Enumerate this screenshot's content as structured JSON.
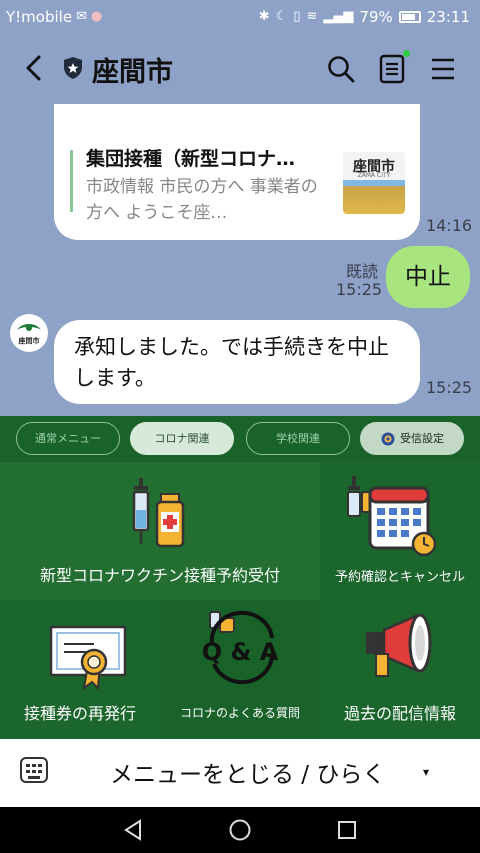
{
  "status_bar": {
    "carrier": "Y!mobile",
    "battery": "79%",
    "time": "23:11"
  },
  "header": {
    "title": "座間市"
  },
  "chat": {
    "link_card": {
      "title": "集団接種（新型コロナ…",
      "description": "市政情報 市民の方へ 事業者の方へ ようこそ座…",
      "thumb_title": "座間市",
      "thumb_sub": "ZAMA CITY",
      "time": "14:16"
    },
    "my_message": {
      "text": "中止",
      "read": "既読",
      "time": "15:25"
    },
    "bot_message": {
      "avatar_text": "座間市",
      "text": "承知しました。では手続きを中止します。",
      "time": "15:25"
    }
  },
  "rich_menu": {
    "tabs": [
      {
        "label": "通常メニュー"
      },
      {
        "label": "コロナ関連"
      },
      {
        "label": "学校関連"
      },
      {
        "label": "受信設定"
      }
    ],
    "items": [
      {
        "label": "新型コロナワクチン接種予約受付",
        "icon": "vaccine-icon"
      },
      {
        "label": "予約確認とキャンセル",
        "icon": "calendar-icon"
      },
      {
        "label": "接種券の再発行",
        "icon": "certificate-icon"
      },
      {
        "label": "コロナのよくある質問",
        "icon": "qa-icon",
        "icon_text": "Q & A"
      },
      {
        "label": "過去の配信情報",
        "icon": "megaphone-icon"
      }
    ]
  },
  "menu_bar": {
    "label": "メニューをとじる / ひらく",
    "caret": "▾"
  },
  "colors": {
    "bg": "#8ea2c8",
    "menu_green": "#19622a",
    "my_bubble": "#a8e57f"
  }
}
